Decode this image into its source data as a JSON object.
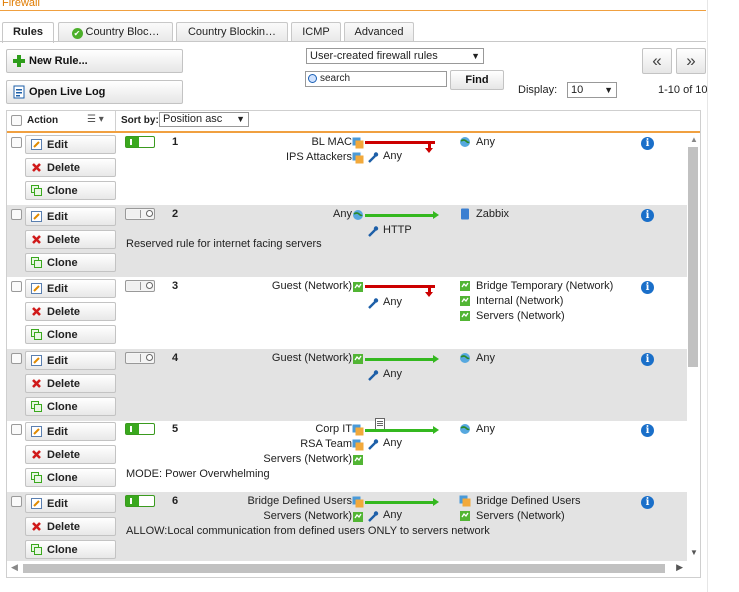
{
  "page": {
    "title": "Firewall"
  },
  "tabs": [
    {
      "label": "Rules",
      "active": true
    },
    {
      "label": "Country Bloc…",
      "icon": "check-circle-icon"
    },
    {
      "label": "Country Blockin…"
    },
    {
      "label": "ICMP"
    },
    {
      "label": "Advanced"
    }
  ],
  "toolbar": {
    "new_rule": "New Rule...",
    "open_live_log": "Open Live Log",
    "filter_select": "User-created firewall rules",
    "search_placeholder": "search",
    "find": "Find",
    "display_label": "Display:",
    "display_value": "10",
    "count": "1-10 of 10",
    "prev": "«",
    "next": "»"
  },
  "grid": {
    "action_header": "Action",
    "sort_label": "Sort by:",
    "sort_value": "Position asc",
    "edit": "Edit",
    "delete": "Delete",
    "clone": "Clone",
    "rules": [
      {
        "position": "1",
        "enabled": true,
        "action": "drop",
        "sources": [
          "BL MAC",
          "IPS Attackers"
        ],
        "service": "Any",
        "destinations": [
          "Any"
        ],
        "description": ""
      },
      {
        "position": "2",
        "enabled": false,
        "action": "allow",
        "sources": [
          "Any"
        ],
        "service": "HTTP",
        "destinations": [
          "Zabbix"
        ],
        "description": "Reserved rule for internet facing servers"
      },
      {
        "position": "3",
        "enabled": false,
        "action": "drop",
        "sources": [
          "Guest (Network)"
        ],
        "service": "Any",
        "destinations": [
          "Bridge Temporary (Network)",
          "Internal (Network)",
          "Servers (Network)"
        ],
        "description": ""
      },
      {
        "position": "4",
        "enabled": false,
        "action": "allow",
        "sources": [
          "Guest (Network)"
        ],
        "service": "Any",
        "destinations": [
          "Any"
        ],
        "description": ""
      },
      {
        "position": "5",
        "enabled": true,
        "action": "allow",
        "sources": [
          "Corp IT",
          "RSA Team",
          "Servers (Network)"
        ],
        "service": "Any",
        "destinations": [
          "Any"
        ],
        "description": "MODE: Power Overwhelming"
      },
      {
        "position": "6",
        "enabled": true,
        "action": "allow",
        "sources": [
          "Bridge Defined Users",
          "Servers (Network)"
        ],
        "service": "Any",
        "destinations": [
          "Bridge Defined Users",
          "Servers (Network)"
        ],
        "description": "ALLOW:Local communication from defined users ONLY to servers network"
      }
    ]
  },
  "colors": {
    "accent_orange": "#f0a040",
    "drop_red": "#cc0000",
    "allow_green": "#34b81f",
    "info_blue": "#1a6fc9"
  }
}
